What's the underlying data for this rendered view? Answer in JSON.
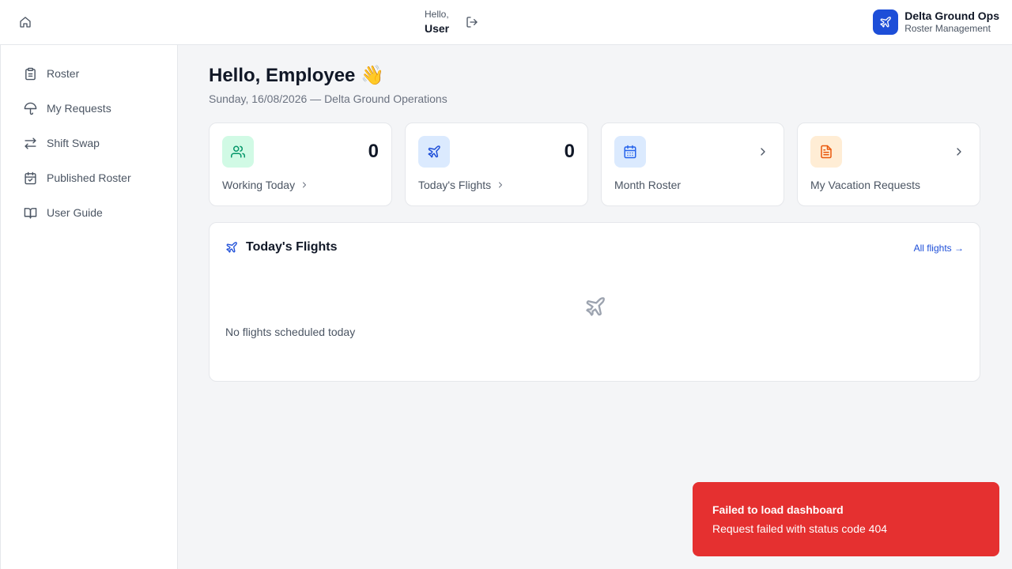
{
  "header": {
    "greeting_small": "Hello,",
    "greeting_name": "User",
    "brand_title": "Delta Ground Ops",
    "brand_subtitle": "Roster Management"
  },
  "sidebar": {
    "items": [
      {
        "label": "Roster",
        "icon": "clipboard-icon"
      },
      {
        "label": "My Requests",
        "icon": "umbrella-icon"
      },
      {
        "label": "Shift Swap",
        "icon": "swap-arrows-icon"
      },
      {
        "label": "Published Roster",
        "icon": "calendar-check-icon"
      },
      {
        "label": "User Guide",
        "icon": "book-icon"
      }
    ]
  },
  "main": {
    "title": "Hello, Employee 👋",
    "subtitle": "Sunday, 16/08/2026 — Delta Ground Operations",
    "cards": [
      {
        "label": "Working Today",
        "value": "0",
        "icon": "users-icon",
        "accent": "#d1fae5",
        "icon_color": "#059669"
      },
      {
        "label": "Today's Flights",
        "value": "0",
        "icon": "plane-icon",
        "accent": "#dbeafe",
        "icon_color": "#1d4ed8"
      },
      {
        "label": "Month Roster",
        "icon": "calendar-icon",
        "accent": "#dbeafe",
        "icon_color": "#2563eb"
      },
      {
        "label": "My Vacation Requests",
        "icon": "document-icon",
        "accent": "#ffedd5",
        "icon_color": "#ea580c"
      }
    ],
    "flights_panel": {
      "title": "Today's Flights",
      "link": "All flights →",
      "empty_text": "No flights scheduled today"
    }
  },
  "toast": {
    "title": "Failed to load dashboard",
    "message": "Request failed with status code 404",
    "color": "#e53030"
  }
}
